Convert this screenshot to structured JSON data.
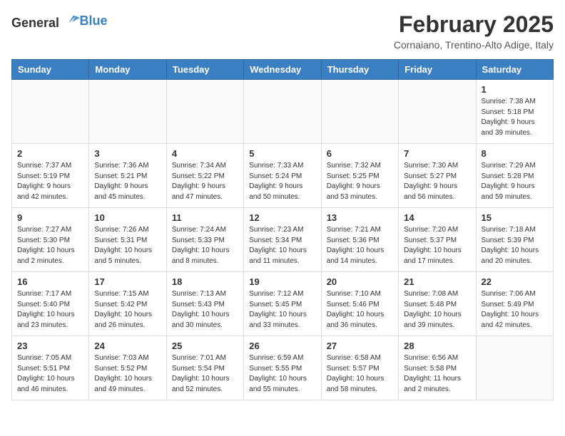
{
  "header": {
    "logo": {
      "general": "General",
      "blue": "Blue"
    },
    "month_year": "February 2025",
    "location": "Cornaiano, Trentino-Alto Adige, Italy"
  },
  "weekdays": [
    "Sunday",
    "Monday",
    "Tuesday",
    "Wednesday",
    "Thursday",
    "Friday",
    "Saturday"
  ],
  "weeks": [
    [
      {
        "day": "",
        "info": ""
      },
      {
        "day": "",
        "info": ""
      },
      {
        "day": "",
        "info": ""
      },
      {
        "day": "",
        "info": ""
      },
      {
        "day": "",
        "info": ""
      },
      {
        "day": "",
        "info": ""
      },
      {
        "day": "1",
        "info": "Sunrise: 7:38 AM\nSunset: 5:18 PM\nDaylight: 9 hours and 39 minutes."
      }
    ],
    [
      {
        "day": "2",
        "info": "Sunrise: 7:37 AM\nSunset: 5:19 PM\nDaylight: 9 hours and 42 minutes."
      },
      {
        "day": "3",
        "info": "Sunrise: 7:36 AM\nSunset: 5:21 PM\nDaylight: 9 hours and 45 minutes."
      },
      {
        "day": "4",
        "info": "Sunrise: 7:34 AM\nSunset: 5:22 PM\nDaylight: 9 hours and 47 minutes."
      },
      {
        "day": "5",
        "info": "Sunrise: 7:33 AM\nSunset: 5:24 PM\nDaylight: 9 hours and 50 minutes."
      },
      {
        "day": "6",
        "info": "Sunrise: 7:32 AM\nSunset: 5:25 PM\nDaylight: 9 hours and 53 minutes."
      },
      {
        "day": "7",
        "info": "Sunrise: 7:30 AM\nSunset: 5:27 PM\nDaylight: 9 hours and 56 minutes."
      },
      {
        "day": "8",
        "info": "Sunrise: 7:29 AM\nSunset: 5:28 PM\nDaylight: 9 hours and 59 minutes."
      }
    ],
    [
      {
        "day": "9",
        "info": "Sunrise: 7:27 AM\nSunset: 5:30 PM\nDaylight: 10 hours and 2 minutes."
      },
      {
        "day": "10",
        "info": "Sunrise: 7:26 AM\nSunset: 5:31 PM\nDaylight: 10 hours and 5 minutes."
      },
      {
        "day": "11",
        "info": "Sunrise: 7:24 AM\nSunset: 5:33 PM\nDaylight: 10 hours and 8 minutes."
      },
      {
        "day": "12",
        "info": "Sunrise: 7:23 AM\nSunset: 5:34 PM\nDaylight: 10 hours and 11 minutes."
      },
      {
        "day": "13",
        "info": "Sunrise: 7:21 AM\nSunset: 5:36 PM\nDaylight: 10 hours and 14 minutes."
      },
      {
        "day": "14",
        "info": "Sunrise: 7:20 AM\nSunset: 5:37 PM\nDaylight: 10 hours and 17 minutes."
      },
      {
        "day": "15",
        "info": "Sunrise: 7:18 AM\nSunset: 5:39 PM\nDaylight: 10 hours and 20 minutes."
      }
    ],
    [
      {
        "day": "16",
        "info": "Sunrise: 7:17 AM\nSunset: 5:40 PM\nDaylight: 10 hours and 23 minutes."
      },
      {
        "day": "17",
        "info": "Sunrise: 7:15 AM\nSunset: 5:42 PM\nDaylight: 10 hours and 26 minutes."
      },
      {
        "day": "18",
        "info": "Sunrise: 7:13 AM\nSunset: 5:43 PM\nDaylight: 10 hours and 30 minutes."
      },
      {
        "day": "19",
        "info": "Sunrise: 7:12 AM\nSunset: 5:45 PM\nDaylight: 10 hours and 33 minutes."
      },
      {
        "day": "20",
        "info": "Sunrise: 7:10 AM\nSunset: 5:46 PM\nDaylight: 10 hours and 36 minutes."
      },
      {
        "day": "21",
        "info": "Sunrise: 7:08 AM\nSunset: 5:48 PM\nDaylight: 10 hours and 39 minutes."
      },
      {
        "day": "22",
        "info": "Sunrise: 7:06 AM\nSunset: 5:49 PM\nDaylight: 10 hours and 42 minutes."
      }
    ],
    [
      {
        "day": "23",
        "info": "Sunrise: 7:05 AM\nSunset: 5:51 PM\nDaylight: 10 hours and 46 minutes."
      },
      {
        "day": "24",
        "info": "Sunrise: 7:03 AM\nSunset: 5:52 PM\nDaylight: 10 hours and 49 minutes."
      },
      {
        "day": "25",
        "info": "Sunrise: 7:01 AM\nSunset: 5:54 PM\nDaylight: 10 hours and 52 minutes."
      },
      {
        "day": "26",
        "info": "Sunrise: 6:59 AM\nSunset: 5:55 PM\nDaylight: 10 hours and 55 minutes."
      },
      {
        "day": "27",
        "info": "Sunrise: 6:58 AM\nSunset: 5:57 PM\nDaylight: 10 hours and 58 minutes."
      },
      {
        "day": "28",
        "info": "Sunrise: 6:56 AM\nSunset: 5:58 PM\nDaylight: 11 hours and 2 minutes."
      },
      {
        "day": "",
        "info": ""
      }
    ]
  ]
}
